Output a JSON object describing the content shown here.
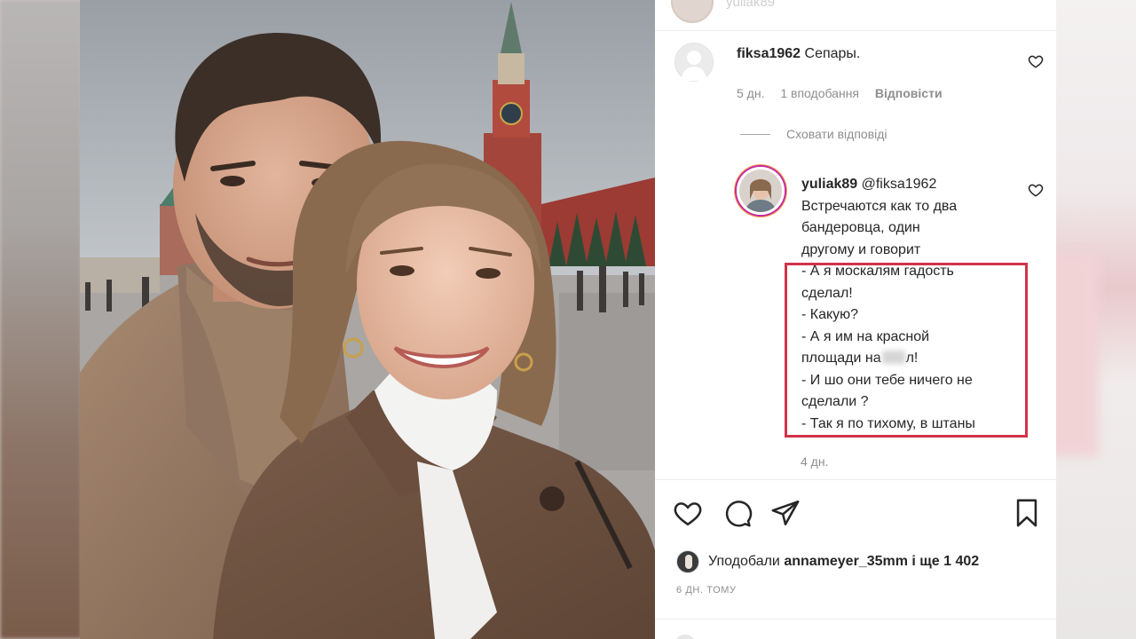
{
  "post": {
    "top_user_ghost": "yuliak89"
  },
  "comment1": {
    "username": "fiksa1962",
    "text": "Сепары.",
    "time": "5 дн.",
    "likes": "1 вподобання",
    "reply": "Відповісти"
  },
  "hide_replies": "Сховати відповіді",
  "comment2": {
    "username": "yuliak89",
    "mention": "@fiksa1962",
    "lines": [
      "Встречаются как то два",
      "бандеровца, один",
      "другому и говорит",
      "- А я москалям гадость",
      "сделал!",
      "- Какую?",
      "- А я им на красной",
      "площади на",
      "л!",
      "- И шо они тебе ничего не",
      "сделали ?",
      "- Так я по тихому, в штаны"
    ],
    "time": "4 дн."
  },
  "likes": {
    "prefix": "Уподобали",
    "user": "annameyer_35mm",
    "suffix": "і ще 1 402"
  },
  "time_ago": "6 ДН. ТОМУ",
  "colors": {
    "highlight_border": "#d1334a",
    "text": "#262626",
    "muted": "#8e8e8e"
  },
  "icons": [
    "heart-icon",
    "comment-icon",
    "share-icon",
    "bookmark-icon"
  ]
}
